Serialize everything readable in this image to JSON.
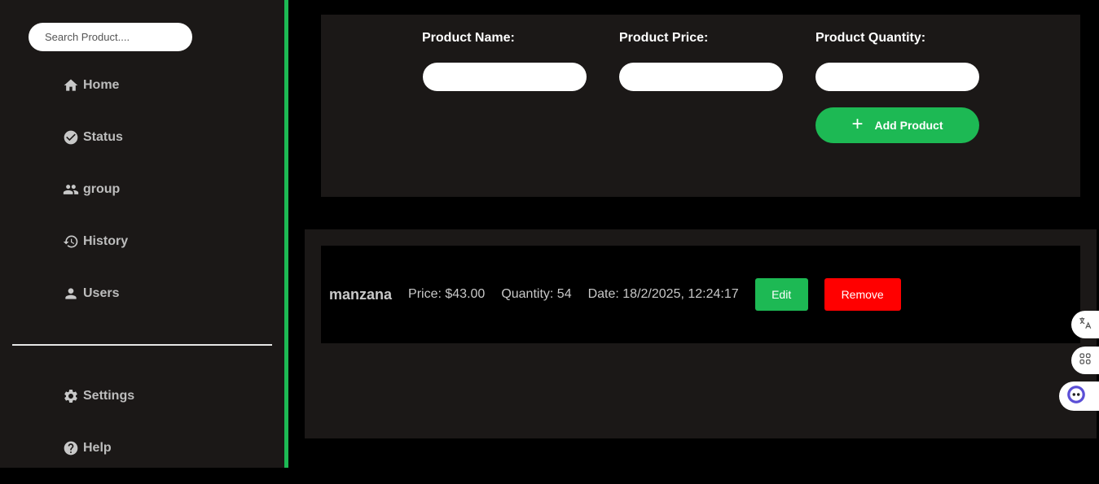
{
  "sidebar": {
    "search": {
      "placeholder": "Search Product...."
    },
    "nav": [
      {
        "label": "Home",
        "icon": "home-icon"
      },
      {
        "label": "Status",
        "icon": "check-circle-icon"
      },
      {
        "label": "group",
        "icon": "group-icon"
      },
      {
        "label": "History",
        "icon": "history-icon"
      },
      {
        "label": "Users",
        "icon": "user-icon"
      }
    ],
    "bottom_nav": [
      {
        "label": "Settings",
        "icon": "gear-icon"
      },
      {
        "label": "Help",
        "icon": "help-icon"
      }
    ]
  },
  "form": {
    "name_label": "Product Name:",
    "name_value": "",
    "price_label": "Product Price:",
    "price_value": "",
    "quantity_label": "Product Quantity:",
    "quantity_value": "",
    "add_button_label": "Add Product",
    "add_button_icon": "plus-icon"
  },
  "products": [
    {
      "name": "manzana",
      "price": "Price: $43.00",
      "quantity": "Quantity: 54",
      "date": "Date: 18/2/2025, 12:24:17",
      "edit_label": "Edit",
      "remove_label": "Remove"
    }
  ],
  "floating_widgets": [
    "translate-icon",
    "apps-icon",
    "assistant-icon"
  ],
  "colors": {
    "accent": "#1db954",
    "danger": "#ff0000",
    "panel": "#1b1817",
    "background": "#000000"
  }
}
